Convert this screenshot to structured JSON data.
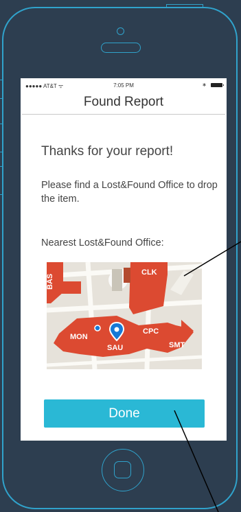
{
  "status": {
    "carrier": "AT&T",
    "time": "7:05 PM"
  },
  "nav": {
    "title": "Found Report"
  },
  "content": {
    "thanks": "Thanks for your report!",
    "instruction": "Please find a Lost&Found Office to drop the item.",
    "nearest_label": "Nearest Lost&Found Office:"
  },
  "map": {
    "labels": {
      "bas": "BAS",
      "clk": "CLK",
      "mon": "MON",
      "sau": "SAU",
      "cpc": "CPC",
      "smt": "SMT"
    },
    "building_color": "#dc4a31",
    "pin_color": "#1679d6"
  },
  "actions": {
    "done_label": "Done"
  },
  "colors": {
    "accent": "#2ab8d5",
    "outline": "#30a3cc",
    "background": "#2d3e50"
  }
}
